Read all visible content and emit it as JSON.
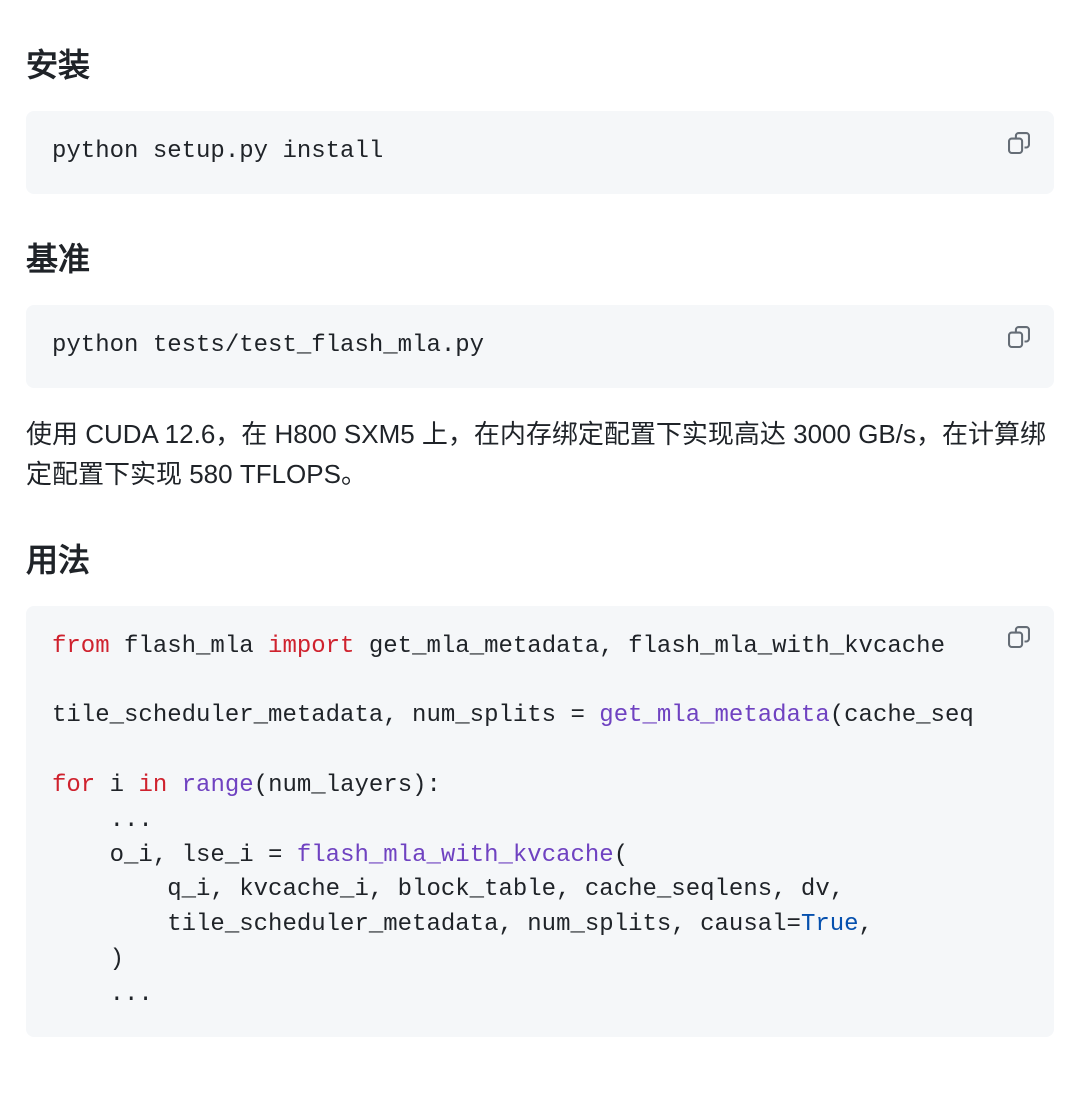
{
  "sections": {
    "install": {
      "heading": "安装",
      "code": "python setup.py install"
    },
    "benchmark": {
      "heading": "基准",
      "code": "python tests/test_flash_mla.py",
      "description": "使用 CUDA 12.6，在 H800 SXM5 上，在内存绑定配置下实现高达 3000 GB/s，在计算绑定配置下实现 580 TFLOPS。"
    },
    "usage": {
      "heading": "用法",
      "code_tokens": [
        {
          "t": "from",
          "c": "kw"
        },
        {
          "t": " flash_mla "
        },
        {
          "t": "import",
          "c": "kw"
        },
        {
          "t": " get_mla_metadata, flash_mla_with_kvcache\n\n"
        },
        {
          "t": "tile_scheduler_metadata, num_splits "
        },
        {
          "t": "=",
          "c": "op"
        },
        {
          "t": " "
        },
        {
          "t": "get_mla_metadata",
          "c": "call"
        },
        {
          "t": "(cache_seq\n\n"
        },
        {
          "t": "for",
          "c": "kw"
        },
        {
          "t": " i "
        },
        {
          "t": "in",
          "c": "kw"
        },
        {
          "t": " "
        },
        {
          "t": "range",
          "c": "fn"
        },
        {
          "t": "(num_layers):\n"
        },
        {
          "t": "    ...\n"
        },
        {
          "t": "    o_i, lse_i "
        },
        {
          "t": "=",
          "c": "op"
        },
        {
          "t": " "
        },
        {
          "t": "flash_mla_with_kvcache",
          "c": "call"
        },
        {
          "t": "(\n"
        },
        {
          "t": "        q_i, kvcache_i, block_table, cache_seqlens, dv,\n"
        },
        {
          "t": "        tile_scheduler_metadata, num_splits, causal"
        },
        {
          "t": "=",
          "c": "op"
        },
        {
          "t": "True",
          "c": "val"
        },
        {
          "t": ",\n"
        },
        {
          "t": "    )\n"
        },
        {
          "t": "    ..."
        }
      ]
    }
  },
  "icons": {
    "copy_label": "Copy"
  }
}
